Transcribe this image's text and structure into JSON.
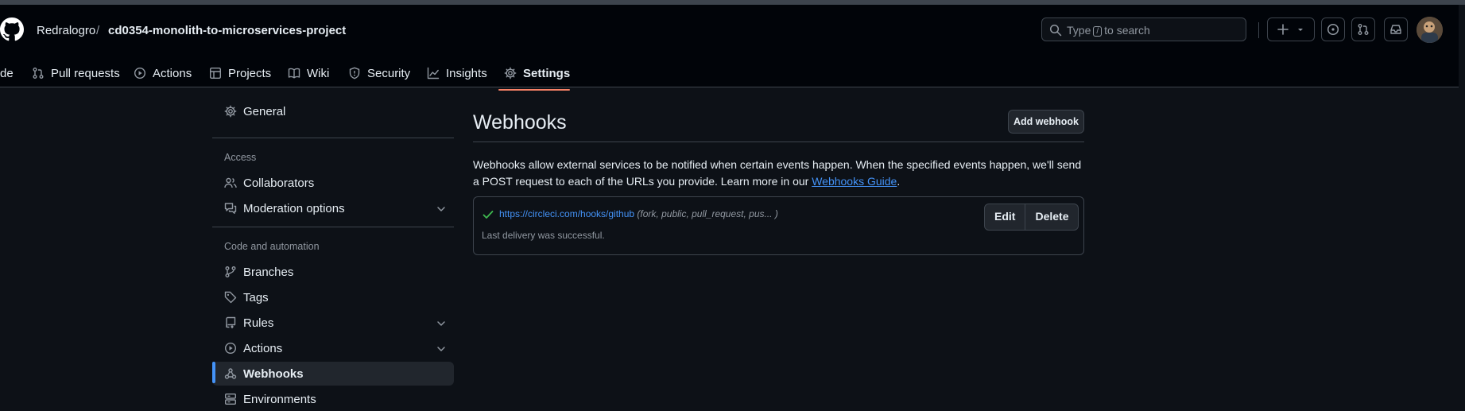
{
  "header": {
    "owner": "Redralogro",
    "separator": "/",
    "repo": "cd0354-monolith-to-microservices-project",
    "search": {
      "before": "Type",
      "key": "/",
      "after": "to search"
    }
  },
  "tabs": [
    {
      "label": "de"
    },
    {
      "label": "Pull requests"
    },
    {
      "label": "Actions"
    },
    {
      "label": "Projects"
    },
    {
      "label": "Wiki"
    },
    {
      "label": "Security"
    },
    {
      "label": "Insights"
    },
    {
      "label": "Settings",
      "active": true
    }
  ],
  "sidebar": {
    "general": "General",
    "groups": [
      "Access",
      "Code and automation"
    ],
    "items": [
      {
        "label": "Collaborators"
      },
      {
        "label": "Moderation options"
      },
      {
        "label": "Branches"
      },
      {
        "label": "Tags"
      },
      {
        "label": "Rules"
      },
      {
        "label": "Actions"
      },
      {
        "label": "Webhooks",
        "active": true
      },
      {
        "label": "Environments"
      }
    ]
  },
  "main": {
    "title": "Webhooks",
    "add_button": "Add webhook",
    "description": "Webhooks allow external services to be notified when certain events happen. When the specified events happen, we'll send a POST request to each of the URLs you provide. Learn more in our",
    "guide_link": "Webhooks Guide",
    "guide_suffix": ".",
    "hook": {
      "url": "https://circleci.com/hooks/github",
      "events": "(fork, public, pull_request, pus... )",
      "status": "Last delivery was successful.",
      "edit_label": "Edit",
      "delete_label": "Delete"
    }
  },
  "colors": {
    "background": "#0d1117",
    "header": "#010409",
    "accent": "#4493f8",
    "tab_underline": "#f78166",
    "success": "#3fb950"
  }
}
